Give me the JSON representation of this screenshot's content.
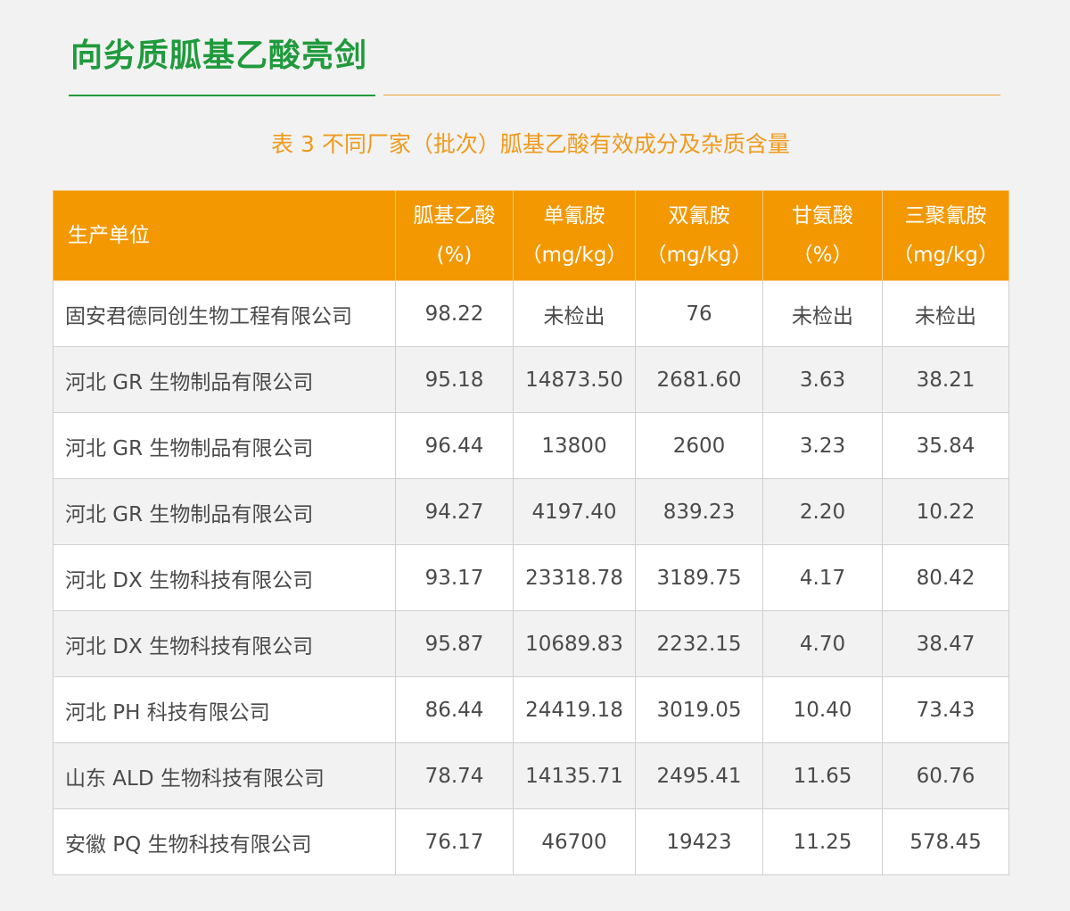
{
  "heading": "向劣质胍基乙酸亮剑",
  "caption": "表 3   不同厂家（批次）胍基乙酸有效成分及杂质含量",
  "colors": {
    "heading_green": "#1f9a3c",
    "header_orange": "#f39800",
    "caption_orange": "#ef9a1c"
  },
  "table": {
    "headers": [
      {
        "name": "生产单位",
        "unit": ""
      },
      {
        "name": "胍基乙酸",
        "unit": "(%)"
      },
      {
        "name": "单氰胺",
        "unit": "（mg/kg）"
      },
      {
        "name": "双氰胺",
        "unit": "（mg/kg）"
      },
      {
        "name": "甘氨酸",
        "unit": "（%）"
      },
      {
        "name": "三聚氰胺",
        "unit": "（mg/kg）"
      }
    ],
    "rows": [
      [
        "固安君德同创生物工程有限公司",
        "98.22",
        "未检出",
        "76",
        "未检出",
        "未检出"
      ],
      [
        "河北 GR 生物制品有限公司",
        "95.18",
        "14873.50",
        "2681.60",
        "3.63",
        "38.21"
      ],
      [
        "河北 GR 生物制品有限公司",
        "96.44",
        "13800",
        "2600",
        "3.23",
        "35.84"
      ],
      [
        "河北 GR 生物制品有限公司",
        "94.27",
        "4197.40",
        "839.23",
        "2.20",
        "10.22"
      ],
      [
        "河北 DX 生物科技有限公司",
        "93.17",
        "23318.78",
        "3189.75",
        "4.17",
        "80.42"
      ],
      [
        "河北 DX 生物科技有限公司",
        "95.87",
        "10689.83",
        "2232.15",
        "4.70",
        "38.47"
      ],
      [
        "河北 PH 科技有限公司",
        "86.44",
        "24419.18",
        "3019.05",
        "10.40",
        "73.43"
      ],
      [
        "山东 ALD 生物科技有限公司",
        "78.74",
        "14135.71",
        "2495.41",
        "11.65",
        "60.76"
      ],
      [
        "安徽 PQ 生物科技有限公司",
        "76.17",
        "46700",
        "19423",
        "11.25",
        "578.45"
      ]
    ]
  }
}
